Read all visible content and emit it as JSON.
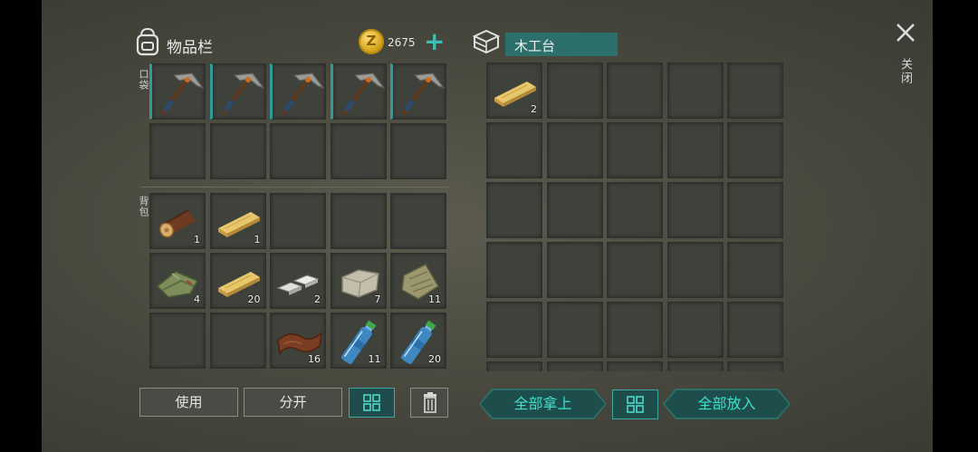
{
  "inventory": {
    "title": "物品栏",
    "coins": "2675",
    "pocket_label": "口袋",
    "backpack_label": "背包"
  },
  "pocket_items": [
    {
      "item": "pickaxe",
      "count": ""
    },
    {
      "item": "pickaxe",
      "count": ""
    },
    {
      "item": "pickaxe",
      "count": ""
    },
    {
      "item": "pickaxe",
      "count": ""
    },
    {
      "item": "pickaxe",
      "count": ""
    },
    {
      "item": "",
      "count": ""
    },
    {
      "item": "",
      "count": ""
    },
    {
      "item": "",
      "count": ""
    },
    {
      "item": "",
      "count": ""
    },
    {
      "item": "",
      "count": ""
    }
  ],
  "backpack_items": [
    {
      "item": "log",
      "count": "1"
    },
    {
      "item": "plank",
      "count": "1"
    },
    {
      "item": "",
      "count": ""
    },
    {
      "item": "",
      "count": ""
    },
    {
      "item": "",
      "count": ""
    },
    {
      "item": "cloth",
      "count": "4"
    },
    {
      "item": "plank",
      "count": "20"
    },
    {
      "item": "iron-bars",
      "count": "2"
    },
    {
      "item": "stone",
      "count": "7"
    },
    {
      "item": "plant-fiber",
      "count": "11"
    },
    {
      "item": "",
      "count": ""
    },
    {
      "item": "",
      "count": ""
    },
    {
      "item": "leather",
      "count": "16"
    },
    {
      "item": "water-bottle",
      "count": "11"
    },
    {
      "item": "water-bottle",
      "count": "20"
    }
  ],
  "buttons": {
    "use": "使用",
    "split": "分开",
    "take_all": "全部拿上",
    "put_all": "全部放入"
  },
  "station": {
    "title": "木工台",
    "slots": [
      {
        "item": "plank",
        "count": "2"
      }
    ]
  },
  "close_label": "关闭",
  "colors": {
    "accent": "#3fbfb3",
    "button_teal": "#1f4d4b",
    "slot": "#3f413b"
  }
}
